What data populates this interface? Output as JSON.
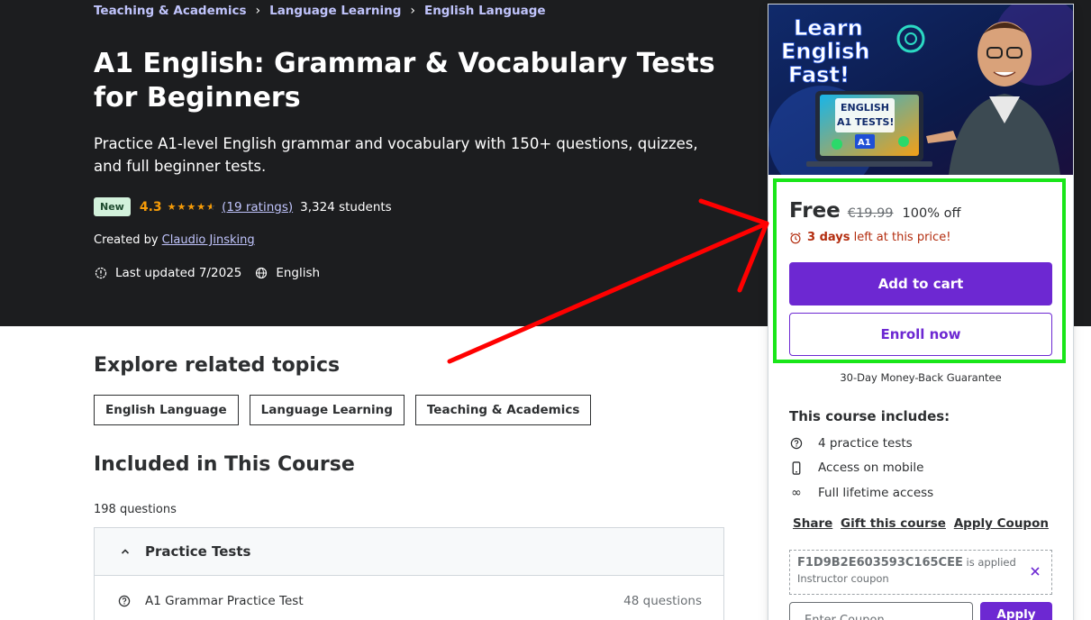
{
  "breadcrumb": [
    "Teaching & Academics",
    "Language Learning",
    "English Language"
  ],
  "course": {
    "title": "A1 English: Grammar & Vocabulary Tests for Beginners",
    "subtitle": "Practice A1-level English grammar and vocabulary with 150+ questions, quizzes, and full beginner tests.",
    "badge": "New",
    "rating": "4.3",
    "rating_value": 4.3,
    "ratings_count": "(19 ratings)",
    "students": "3,324 students",
    "created_by_label": "Created by",
    "instructor": "Claudio Jinsking",
    "last_updated": "Last updated 7/2025",
    "language": "English"
  },
  "related": {
    "heading": "Explore related topics",
    "topics": [
      "English Language",
      "Language Learning",
      "Teaching & Academics"
    ]
  },
  "included": {
    "heading": "Included in This Course",
    "count": "198 questions",
    "section_title": "Practice Tests",
    "items": [
      {
        "title": "A1 Grammar Practice Test",
        "count": "48 questions"
      }
    ]
  },
  "thumbnail": {
    "line1": "Learn",
    "line2": "English",
    "line3": "Fast!",
    "screen_line1": "ENGLISH",
    "screen_line2": "A1 TESTS!",
    "screen_line3": "A1"
  },
  "purchase": {
    "price": "Free",
    "original_price": "€19.99",
    "discount": "100% off",
    "timer_bold": "3 days",
    "timer_rest": " left at this price!",
    "add_to_cart": "Add to cart",
    "enroll": "Enroll now",
    "guarantee": "30-Day Money-Back Guarantee"
  },
  "includes": {
    "heading": "This course includes:",
    "items": [
      "4 practice tests",
      "Access on mobile",
      "Full lifetime access"
    ]
  },
  "actions": {
    "share": "Share",
    "gift": "Gift this course",
    "apply_coupon": "Apply Coupon"
  },
  "coupon": {
    "code": "F1D9B2E603593C165CEE",
    "applied_text": " is applied",
    "type": "Instructor coupon",
    "input_placeholder": "Enter Coupon",
    "apply_label": "Apply"
  },
  "colors": {
    "hero_bg": "#1c1d1f",
    "accent": "#6d28d2",
    "link": "#c0c4fc",
    "star": "#f69c08",
    "highlight": "#19e619",
    "arrow": "#ff0000",
    "timer": "#b32d0f"
  }
}
